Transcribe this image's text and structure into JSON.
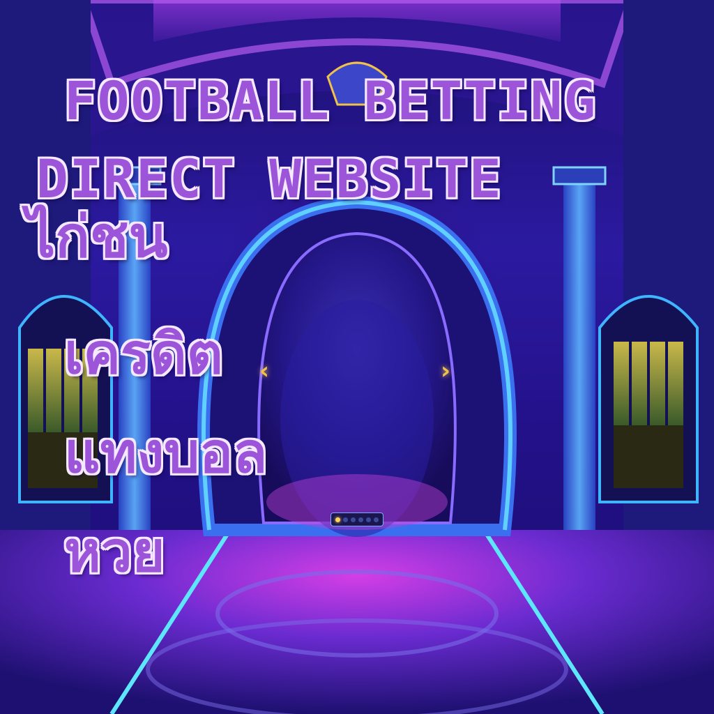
{
  "headline": {
    "line1": "FOOTBALL BETTING",
    "line2": "DIRECT WEBSITE"
  },
  "thai_lines": [
    "ไก่ชน",
    "เครดิต",
    "แทงบอล",
    "หวย"
  ],
  "carousel": {
    "prev_icon": "chevron-left-icon",
    "next_icon": "chevron-right-icon",
    "prev_glyph": "‹",
    "next_glyph": "›",
    "dots_total": 6,
    "active_dot": 1
  },
  "colors": {
    "text_fill": "#9c55d8",
    "text_outline": "#f4e9ff",
    "portal_glow": "#5fd0ff",
    "accent_gold": "#f0c24a",
    "floor_magenta": "#c030d8"
  }
}
